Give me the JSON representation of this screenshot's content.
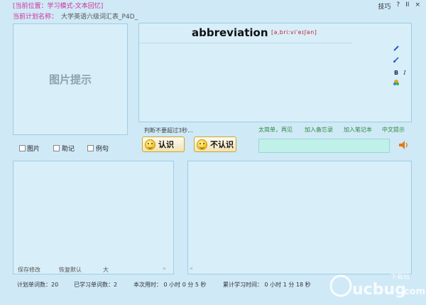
{
  "header": {
    "location": "[当前位置：学习模式-文本回忆]",
    "menu": [
      "技巧",
      "?",
      "II",
      "×"
    ],
    "plan_label": "当前计划名称：",
    "plan_value": "大学英语六级词汇表_P4D_"
  },
  "image_panel": {
    "hint": "图片提示"
  },
  "word_panel": {
    "word": "abbreviation",
    "phonetic": "[əˌbriːviˈeɪʃən]",
    "tools": [
      "pen-icon",
      "brush-icon",
      "bold-icon",
      "italic-icon",
      "palette-icon"
    ],
    "bold_glyph": "B",
    "italic_glyph": "I"
  },
  "options": {
    "checkboxes": [
      "图片",
      "助记",
      "例句"
    ]
  },
  "judge_hint": "判断不要超过3秒...",
  "links": [
    "太简单，再见",
    "加入备忘录",
    "加入笔记本",
    "中文提示"
  ],
  "buttons": {
    "know": "认识",
    "dont_know": "不认识"
  },
  "left_panel": {
    "save": "保存修改",
    "restore": "恢复默认",
    "size": "大",
    "expand": "»"
  },
  "right_panel": {
    "collapse": "«"
  },
  "status": {
    "plan_words": "计划单词数：20",
    "learned_words": "已学习单词数：2",
    "this_time": "本次用时：  0 小时 0 分 5 秒",
    "total_time": "累计学习时间：  0 小时 1 分 18 秒"
  },
  "watermark": {
    "text": "ucbug",
    "sub": "下载站",
    "suffix": ".com"
  },
  "colors": {
    "accent": "#d0309a",
    "link": "#2e8b3a",
    "background": "#cfe9f7"
  }
}
